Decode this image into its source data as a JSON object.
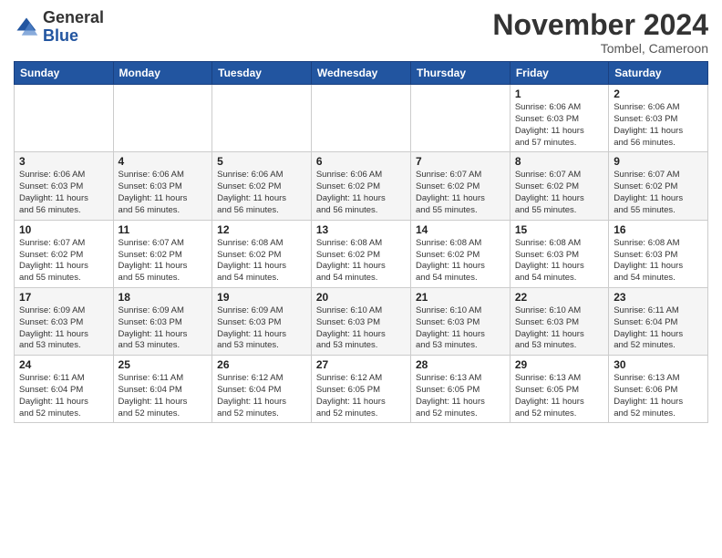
{
  "header": {
    "logo_general": "General",
    "logo_blue": "Blue",
    "month": "November 2024",
    "location": "Tombel, Cameroon"
  },
  "weekdays": [
    "Sunday",
    "Monday",
    "Tuesday",
    "Wednesday",
    "Thursday",
    "Friday",
    "Saturday"
  ],
  "rows": [
    [
      {
        "day": "",
        "info": ""
      },
      {
        "day": "",
        "info": ""
      },
      {
        "day": "",
        "info": ""
      },
      {
        "day": "",
        "info": ""
      },
      {
        "day": "",
        "info": ""
      },
      {
        "day": "1",
        "info": "Sunrise: 6:06 AM\nSunset: 6:03 PM\nDaylight: 11 hours\nand 57 minutes."
      },
      {
        "day": "2",
        "info": "Sunrise: 6:06 AM\nSunset: 6:03 PM\nDaylight: 11 hours\nand 56 minutes."
      }
    ],
    [
      {
        "day": "3",
        "info": "Sunrise: 6:06 AM\nSunset: 6:03 PM\nDaylight: 11 hours\nand 56 minutes."
      },
      {
        "day": "4",
        "info": "Sunrise: 6:06 AM\nSunset: 6:03 PM\nDaylight: 11 hours\nand 56 minutes."
      },
      {
        "day": "5",
        "info": "Sunrise: 6:06 AM\nSunset: 6:02 PM\nDaylight: 11 hours\nand 56 minutes."
      },
      {
        "day": "6",
        "info": "Sunrise: 6:06 AM\nSunset: 6:02 PM\nDaylight: 11 hours\nand 56 minutes."
      },
      {
        "day": "7",
        "info": "Sunrise: 6:07 AM\nSunset: 6:02 PM\nDaylight: 11 hours\nand 55 minutes."
      },
      {
        "day": "8",
        "info": "Sunrise: 6:07 AM\nSunset: 6:02 PM\nDaylight: 11 hours\nand 55 minutes."
      },
      {
        "day": "9",
        "info": "Sunrise: 6:07 AM\nSunset: 6:02 PM\nDaylight: 11 hours\nand 55 minutes."
      }
    ],
    [
      {
        "day": "10",
        "info": "Sunrise: 6:07 AM\nSunset: 6:02 PM\nDaylight: 11 hours\nand 55 minutes."
      },
      {
        "day": "11",
        "info": "Sunrise: 6:07 AM\nSunset: 6:02 PM\nDaylight: 11 hours\nand 55 minutes."
      },
      {
        "day": "12",
        "info": "Sunrise: 6:08 AM\nSunset: 6:02 PM\nDaylight: 11 hours\nand 54 minutes."
      },
      {
        "day": "13",
        "info": "Sunrise: 6:08 AM\nSunset: 6:02 PM\nDaylight: 11 hours\nand 54 minutes."
      },
      {
        "day": "14",
        "info": "Sunrise: 6:08 AM\nSunset: 6:02 PM\nDaylight: 11 hours\nand 54 minutes."
      },
      {
        "day": "15",
        "info": "Sunrise: 6:08 AM\nSunset: 6:03 PM\nDaylight: 11 hours\nand 54 minutes."
      },
      {
        "day": "16",
        "info": "Sunrise: 6:08 AM\nSunset: 6:03 PM\nDaylight: 11 hours\nand 54 minutes."
      }
    ],
    [
      {
        "day": "17",
        "info": "Sunrise: 6:09 AM\nSunset: 6:03 PM\nDaylight: 11 hours\nand 53 minutes."
      },
      {
        "day": "18",
        "info": "Sunrise: 6:09 AM\nSunset: 6:03 PM\nDaylight: 11 hours\nand 53 minutes."
      },
      {
        "day": "19",
        "info": "Sunrise: 6:09 AM\nSunset: 6:03 PM\nDaylight: 11 hours\nand 53 minutes."
      },
      {
        "day": "20",
        "info": "Sunrise: 6:10 AM\nSunset: 6:03 PM\nDaylight: 11 hours\nand 53 minutes."
      },
      {
        "day": "21",
        "info": "Sunrise: 6:10 AM\nSunset: 6:03 PM\nDaylight: 11 hours\nand 53 minutes."
      },
      {
        "day": "22",
        "info": "Sunrise: 6:10 AM\nSunset: 6:03 PM\nDaylight: 11 hours\nand 53 minutes."
      },
      {
        "day": "23",
        "info": "Sunrise: 6:11 AM\nSunset: 6:04 PM\nDaylight: 11 hours\nand 52 minutes."
      }
    ],
    [
      {
        "day": "24",
        "info": "Sunrise: 6:11 AM\nSunset: 6:04 PM\nDaylight: 11 hours\nand 52 minutes."
      },
      {
        "day": "25",
        "info": "Sunrise: 6:11 AM\nSunset: 6:04 PM\nDaylight: 11 hours\nand 52 minutes."
      },
      {
        "day": "26",
        "info": "Sunrise: 6:12 AM\nSunset: 6:04 PM\nDaylight: 11 hours\nand 52 minutes."
      },
      {
        "day": "27",
        "info": "Sunrise: 6:12 AM\nSunset: 6:05 PM\nDaylight: 11 hours\nand 52 minutes."
      },
      {
        "day": "28",
        "info": "Sunrise: 6:13 AM\nSunset: 6:05 PM\nDaylight: 11 hours\nand 52 minutes."
      },
      {
        "day": "29",
        "info": "Sunrise: 6:13 AM\nSunset: 6:05 PM\nDaylight: 11 hours\nand 52 minutes."
      },
      {
        "day": "30",
        "info": "Sunrise: 6:13 AM\nSunset: 6:06 PM\nDaylight: 11 hours\nand 52 minutes."
      }
    ]
  ]
}
